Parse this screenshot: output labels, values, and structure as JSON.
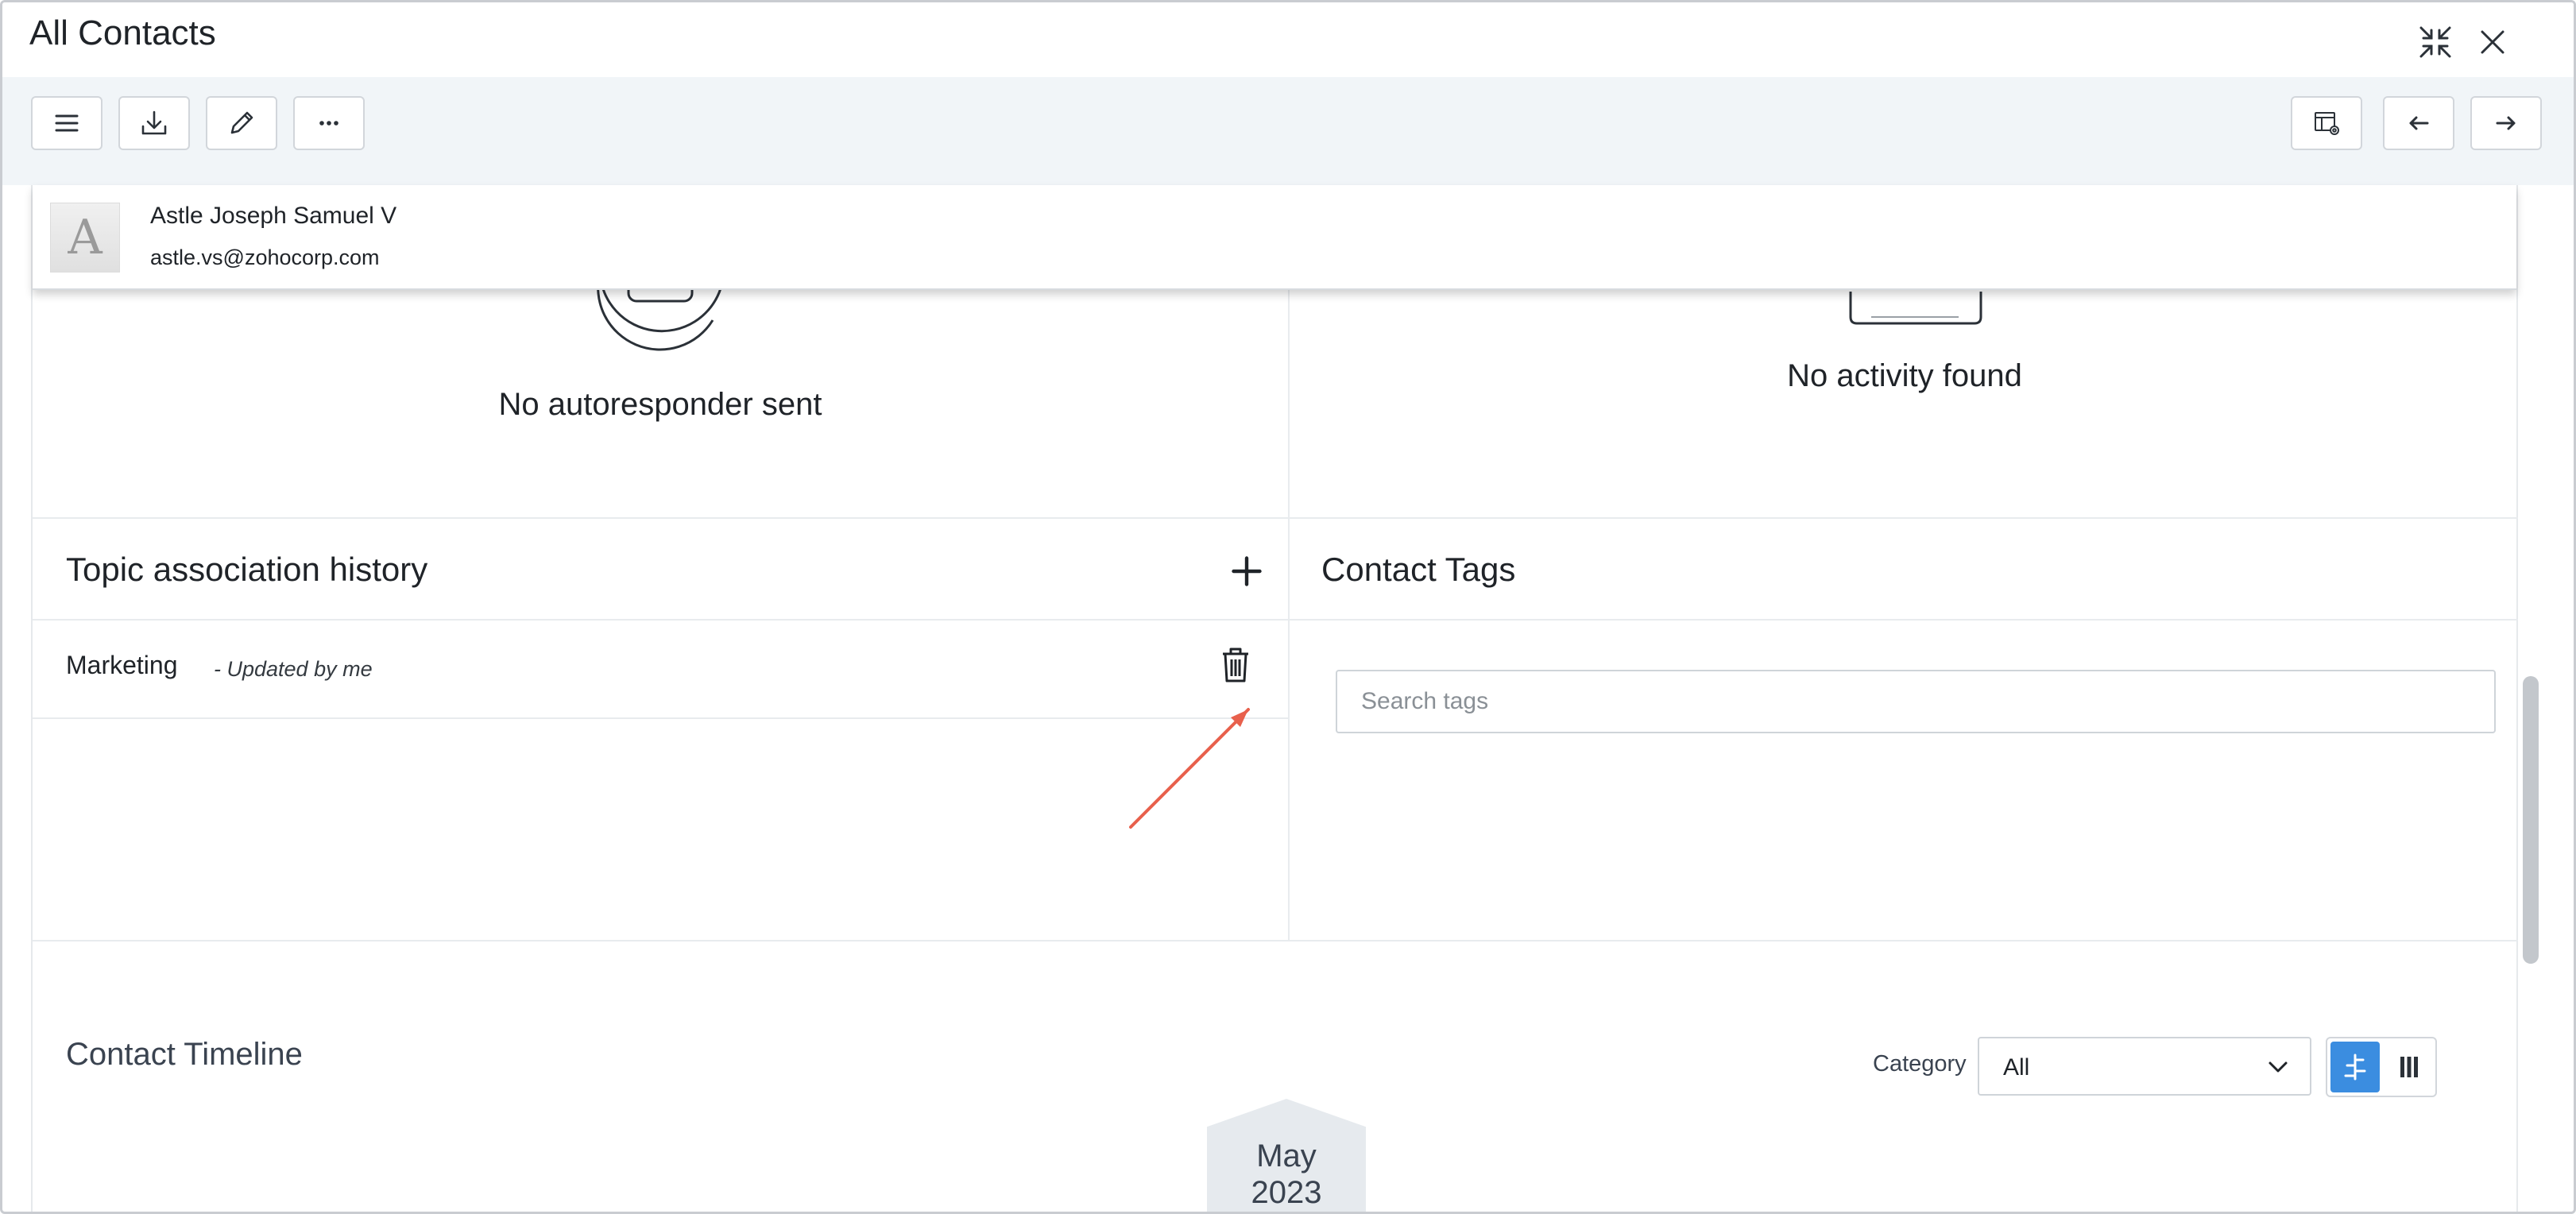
{
  "window": {
    "title": "All Contacts"
  },
  "contact": {
    "avatar_initial": "A",
    "name": "Astle Joseph Samuel V",
    "email": "astle.vs@zohocorp.com"
  },
  "panels": {
    "autoresponder_empty": "No autoresponder sent",
    "activity_empty": "No activity found"
  },
  "topic_history": {
    "title": "Topic association history",
    "rows": [
      {
        "name": "Marketing",
        "meta": "- Updated by me"
      }
    ]
  },
  "contact_tags": {
    "title": "Contact Tags",
    "search_placeholder": "Search tags"
  },
  "timeline": {
    "title": "Contact Timeline",
    "category_label": "Category",
    "category_value": "All",
    "month": "May",
    "year": "2023"
  },
  "colors": {
    "accent": "#3b8de0",
    "arrow": "#e8604c",
    "toolbar_bg": "#f1f5f8"
  },
  "icons": {
    "collapse": "collapse-arrows-icon",
    "close": "close-icon",
    "menu": "hamburger-menu-icon",
    "download": "download-icon",
    "edit": "pencil-icon",
    "more": "ellipsis-icon",
    "layout": "layout-settings-icon",
    "prev": "arrow-left-icon",
    "next": "arrow-right-icon",
    "add": "plus-icon",
    "delete": "trash-icon",
    "chevron": "chevron-down-icon",
    "timeline_view": "timeline-view-icon",
    "column_view": "column-view-icon"
  }
}
